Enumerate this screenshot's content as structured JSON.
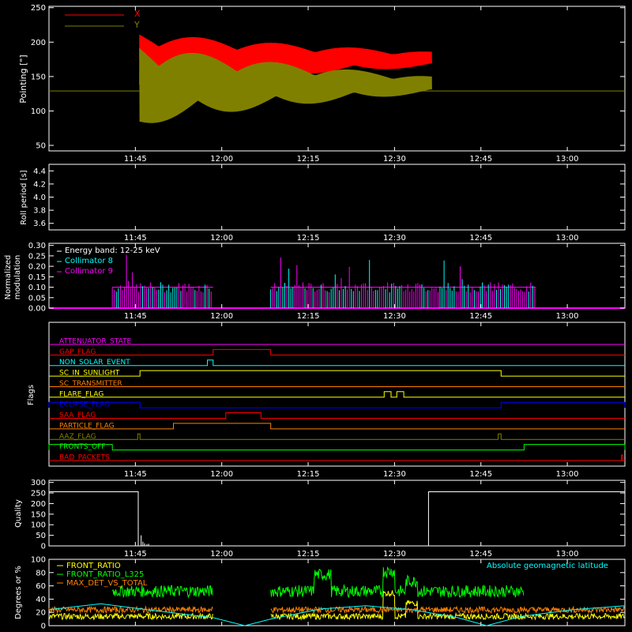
{
  "time_axis": {
    "range_minutes": [
      0,
      100
    ],
    "tick_minutes": [
      15,
      30,
      45,
      60,
      75,
      90
    ],
    "tick_labels": [
      "11:45",
      "12:00",
      "12:15",
      "12:30",
      "12:45",
      "13:00"
    ]
  },
  "chart_data": [
    {
      "type": "line",
      "panel": "pointing",
      "ylabel": "Pointing [\"]",
      "ylim": [
        42,
        252
      ],
      "yticks": [
        50,
        100,
        150,
        200,
        250
      ],
      "legend_position": "top-left",
      "series": [
        {
          "name": "X",
          "color": "#ff0000",
          "center": 175,
          "amp_start": 42,
          "amp_end": 11,
          "t_start": 15.7,
          "t_end": 66.5
        },
        {
          "name": "Y",
          "color": "#808000",
          "center": 138,
          "amp_start": 62,
          "amp_end": 12,
          "t_start": 15.7,
          "t_end": 66.5
        }
      ],
      "baseline": {
        "value": 129,
        "color": "#808000"
      }
    },
    {
      "type": "line",
      "panel": "roll_period",
      "ylabel": "Roll period [s]",
      "ylim": [
        3.5,
        4.5
      ],
      "yticks": [
        3.6,
        3.8,
        4.0,
        4.2,
        4.4
      ],
      "tick_labels": [
        "3.6",
        "3.8",
        "4.0",
        "4.2",
        "4.4"
      ],
      "series": []
    },
    {
      "type": "bar",
      "panel": "modulation",
      "ylabel": "Normalized modulation",
      "ylim": [
        0,
        0.31
      ],
      "yticks": [
        0.0,
        0.05,
        0.1,
        0.15,
        0.2,
        0.25,
        0.3
      ],
      "tick_labels": [
        "0.00",
        "0.05",
        "0.10",
        "0.15",
        "0.20",
        "0.25",
        "0.30"
      ],
      "legend": {
        "title": "Energy band: 12-25 keV",
        "entries": [
          {
            "name": "Collimator 8",
            "color": "#00ffff"
          },
          {
            "name": "Collimator 9",
            "color": "#ff00ff"
          }
        ]
      },
      "intervals": [
        [
          11,
          28.5
        ],
        [
          38.5,
          84.5
        ]
      ],
      "typical_value": 0.1
    },
    {
      "type": "line",
      "panel": "flags",
      "ylabel": "Flags",
      "flags": [
        {
          "name": "ATTENUATOR_STATE",
          "color": "#ff00ff",
          "segments": []
        },
        {
          "name": "GAP_FLAG",
          "color": "#ff0000",
          "segments": [
            [
              28.5,
              38.5
            ]
          ]
        },
        {
          "name": "NON_SOLAR_EVENT",
          "color": "#00ffff",
          "segments": [
            [
              27.5,
              28.5
            ]
          ]
        },
        {
          "name": "SC_IN_SUNLIGHT",
          "color": "#ffff00",
          "segments": [
            [
              15.8,
              78.5
            ]
          ]
        },
        {
          "name": "SC_TRANSMITTER",
          "color": "#ff8000",
          "segments": []
        },
        {
          "name": "FLARE_FLAG",
          "color": "#ffff00",
          "segments": [
            [
              58.2,
              59.4
            ],
            [
              60.4,
              61.6
            ]
          ]
        },
        {
          "name": "ECLIPSE_FLAG",
          "color": "#0000ff",
          "segments": [
            [
              0,
              15.8
            ],
            [
              78.5,
              100
            ]
          ]
        },
        {
          "name": "SAA_FLAG",
          "color": "#ff0000",
          "segments": [
            [
              30.7,
              36.8
            ]
          ]
        },
        {
          "name": "PARTICLE_FLAG",
          "color": "#ff8000",
          "segments": [
            [
              21.6,
              38.5
            ]
          ]
        },
        {
          "name": "AAZ_FLAG",
          "color": "#808000",
          "segments": [
            [
              15.4,
              15.8
            ],
            [
              78.0,
              78.5
            ]
          ]
        },
        {
          "name": "FRONTS_OFF",
          "color": "#00ff00",
          "segments": [
            [
              0,
              11
            ],
            [
              82.5,
              100
            ]
          ]
        },
        {
          "name": "BAD_PACKETS",
          "color": "#ff0000",
          "segments": [
            [
              99.4,
              99.6
            ]
          ]
        }
      ]
    },
    {
      "type": "line",
      "panel": "quality",
      "ylabel": "Quality",
      "ylim": [
        0,
        310
      ],
      "yticks": [
        0,
        50,
        100,
        150,
        200,
        250,
        300
      ],
      "segments": [
        {
          "t_start": 0,
          "t_end": 15.5,
          "value": 256
        },
        {
          "t_start": 65.9,
          "t_end": 100,
          "value": 256
        }
      ],
      "spikes": [
        [
          16.0,
          50
        ],
        [
          16.3,
          20
        ],
        [
          16.6,
          12
        ],
        [
          17.0,
          8
        ],
        [
          17.3,
          10
        ]
      ]
    },
    {
      "type": "line",
      "panel": "geomagnetic",
      "ylabel": "Degrees or %",
      "ylim": [
        0,
        100
      ],
      "yticks": [
        0,
        20,
        40,
        60,
        80,
        100
      ],
      "annotation": "Absolute geomagnetic latitude",
      "series": [
        {
          "name": "FRONT_RATIO",
          "color": "#ffff00",
          "base": 14,
          "t_ranges": [
            [
              0,
              28.5
            ],
            [
              38.5,
              100
            ]
          ]
        },
        {
          "name": "FRONT_RATIO_L325",
          "color": "#00ff00",
          "base": 52,
          "t_ranges": [
            [
              11,
              28.5
            ],
            [
              38.5,
              82.5
            ]
          ]
        },
        {
          "name": "MAX_DET_VS_TOTAL",
          "color": "#ff8000",
          "base": 24,
          "t_ranges": [
            [
              0,
              28.5
            ],
            [
              38.5,
              100
            ]
          ]
        },
        {
          "name": "Absolute geomagnetic latitude",
          "color": "#00ffff",
          "points": [
            [
              0,
              24
            ],
            [
              9,
              33
            ],
            [
              17,
              24
            ],
            [
              28.5,
              12
            ],
            [
              34,
              0
            ],
            [
              38.5,
              10
            ],
            [
              47,
              25
            ],
            [
              55,
              30
            ],
            [
              63,
              24
            ],
            [
              71,
              12
            ],
            [
              76,
              0
            ],
            [
              82,
              14
            ],
            [
              91,
              24
            ],
            [
              100,
              30
            ]
          ]
        }
      ]
    }
  ]
}
